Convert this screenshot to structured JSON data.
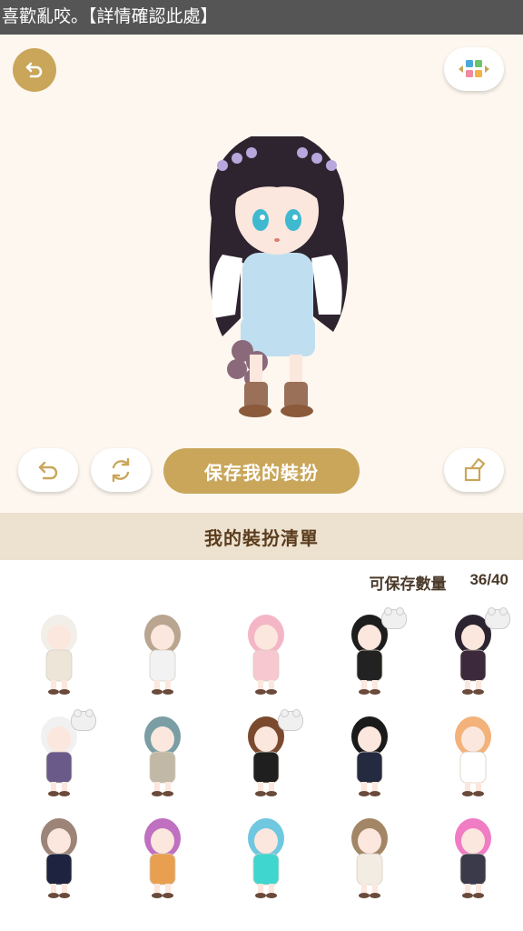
{
  "banner": {
    "text": "喜歡亂咬。【詳情確認此處】"
  },
  "buttons": {
    "save_label": "保存我的裝扮"
  },
  "outfit_list": {
    "title": "我的裝扮清單",
    "capacity_label": "可保存數量",
    "capacity_value": "36/40"
  },
  "thumbnails": [
    {
      "hair": "#f2efe9",
      "outfit": "#ece5d8",
      "badge": false
    },
    {
      "hair": "#b9a590",
      "outfit": "#f2f2f2",
      "badge": false
    },
    {
      "hair": "#f4b6c6",
      "outfit": "#f7c8cf",
      "badge": false
    },
    {
      "hair": "#1d1d1d",
      "outfit": "#222222",
      "badge": true
    },
    {
      "hair": "#2c2430",
      "outfit": "#3c2a3c",
      "badge": true
    },
    {
      "hair": "#f1f1f1",
      "outfit": "#6a5a8a",
      "badge": true
    },
    {
      "hair": "#7a9ea4",
      "outfit": "#c2b8a6",
      "badge": false
    },
    {
      "hair": "#7b4a2e",
      "outfit": "#1f1f1f",
      "badge": true
    },
    {
      "hair": "#1b1b1b",
      "outfit": "#242a40",
      "badge": false
    },
    {
      "hair": "#f2b27a",
      "outfit": "#ffffff",
      "badge": false
    },
    {
      "hair": "#9c8478",
      "outfit": "#1e2440",
      "badge": false
    },
    {
      "hair": "#c070c0",
      "outfit": "#e8a050",
      "badge": false
    },
    {
      "hair": "#6fc7e0",
      "outfit": "#3fd6d0",
      "badge": false
    },
    {
      "hair": "#a28666",
      "outfit": "#f2ece2",
      "badge": false
    },
    {
      "hair": "#f07cc4",
      "outfit": "#3a3a4a",
      "badge": false
    }
  ],
  "colors": {
    "accent": "#c9a65a",
    "header_band": "#ede1cf",
    "banner_bg": "#555555"
  },
  "icons": [
    "back-arrow-icon",
    "theme-grid-icon",
    "undo-icon",
    "refresh-icon",
    "clear-outfit-icon",
    "bear-badge-icon"
  ]
}
